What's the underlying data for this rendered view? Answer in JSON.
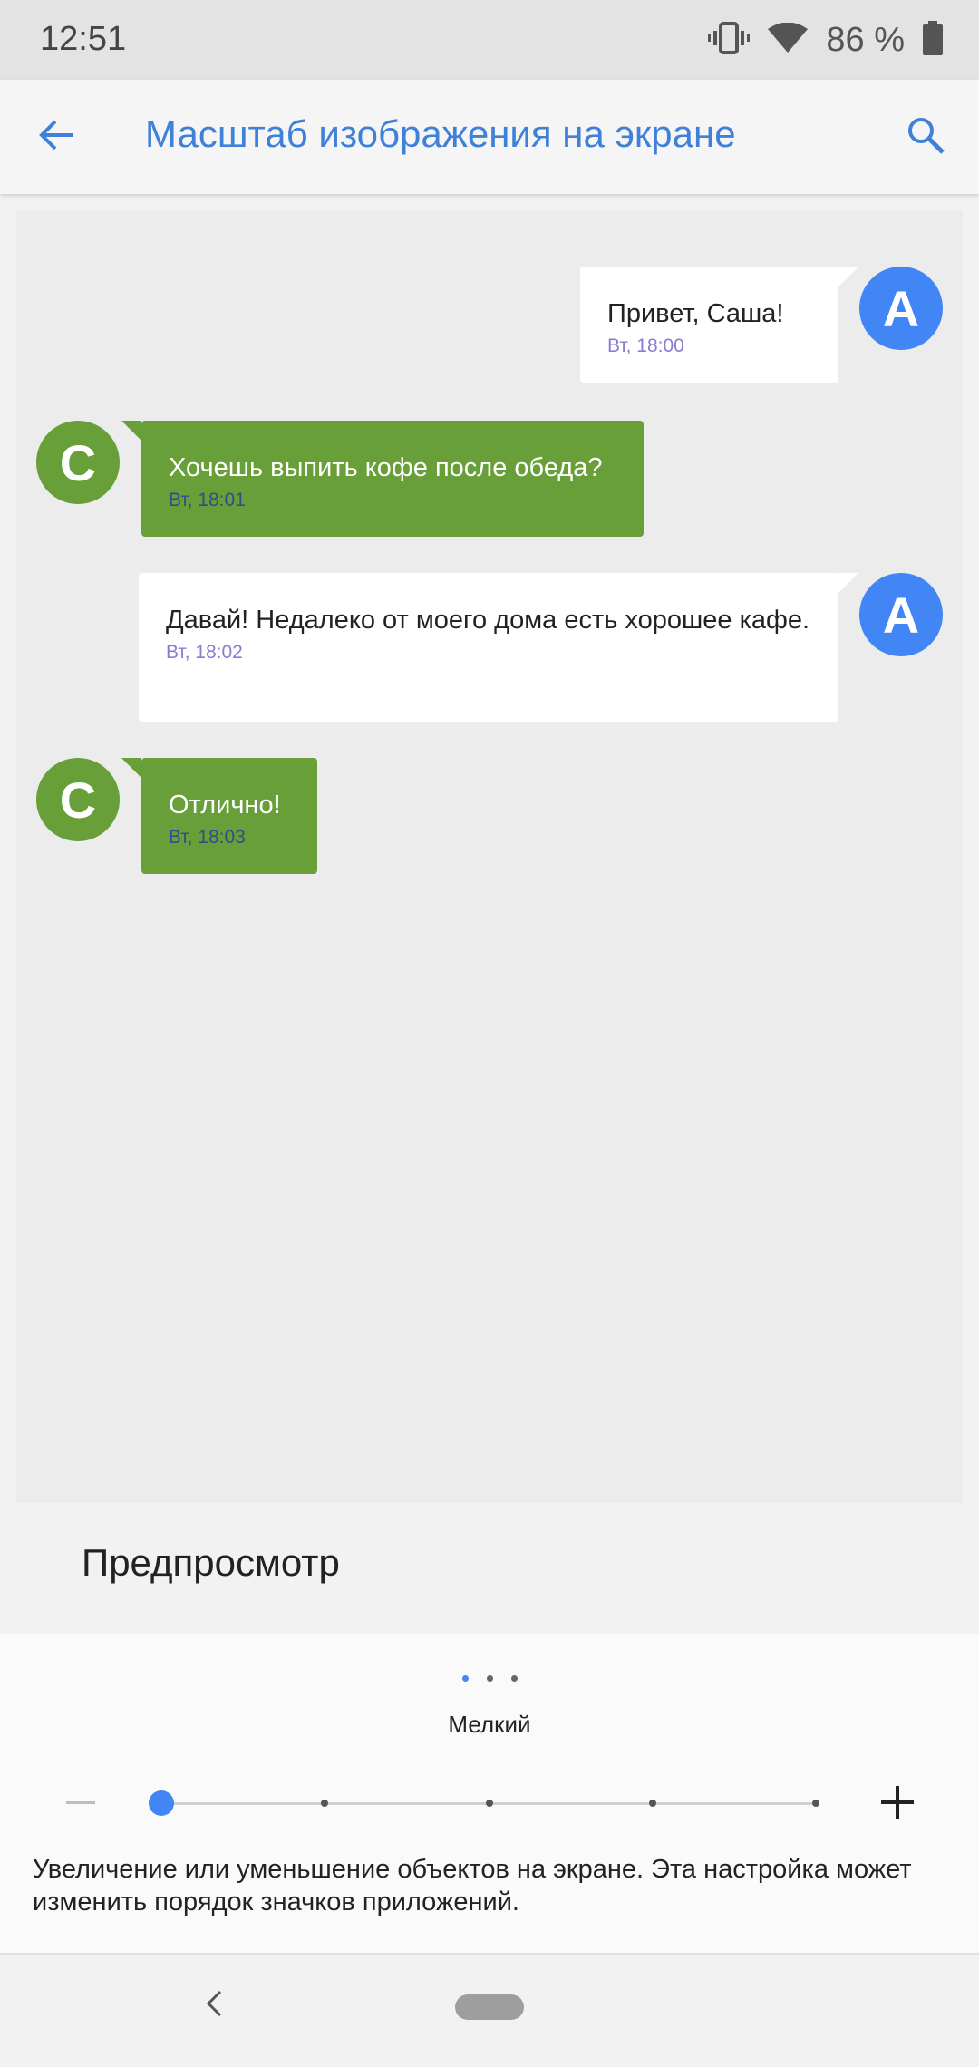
{
  "status_bar": {
    "time": "12:51",
    "battery_text": "86 %",
    "icons": [
      "vibrate-icon",
      "wifi-icon",
      "battery-icon"
    ]
  },
  "app_bar": {
    "title": "Масштаб изображения на экране",
    "back_icon": "arrow-back-icon",
    "search_icon": "search-icon",
    "accent_color": "#3f81d9"
  },
  "preview": {
    "messages": [
      {
        "from": "A",
        "direction": "outgoing",
        "text": "Привет, Саша!",
        "time": "Вт, 18:00"
      },
      {
        "from": "С",
        "direction": "incoming",
        "text": "Хочешь выпить кофе после обеда?",
        "time": "Вт, 18:01"
      },
      {
        "from": "A",
        "direction": "outgoing",
        "text": "Давай! Недалеко от моего дома есть хорошее кафе.",
        "time": "Вт, 18:02"
      },
      {
        "from": "С",
        "direction": "incoming",
        "text": "Отлично!",
        "time": "Вт, 18:03"
      }
    ],
    "label": "Предпросмотр",
    "colors": {
      "avatar_a": "#4285f4",
      "avatar_c": "#689f38",
      "incoming_bubble": "#689f38"
    }
  },
  "settings": {
    "page_indicator": {
      "count": 3,
      "active_index": 0
    },
    "size_label": "Мелкий",
    "slider": {
      "steps": 5,
      "value_index": 0
    },
    "minus_icon": "minus-icon",
    "plus_icon": "plus-icon",
    "description": "Увеличение или уменьшение объектов на экране. Эта настройка может изменить порядок значков приложений."
  },
  "nav_bar": {
    "back_icon": "nav-back-icon",
    "home_icon": "home-pill-icon"
  }
}
